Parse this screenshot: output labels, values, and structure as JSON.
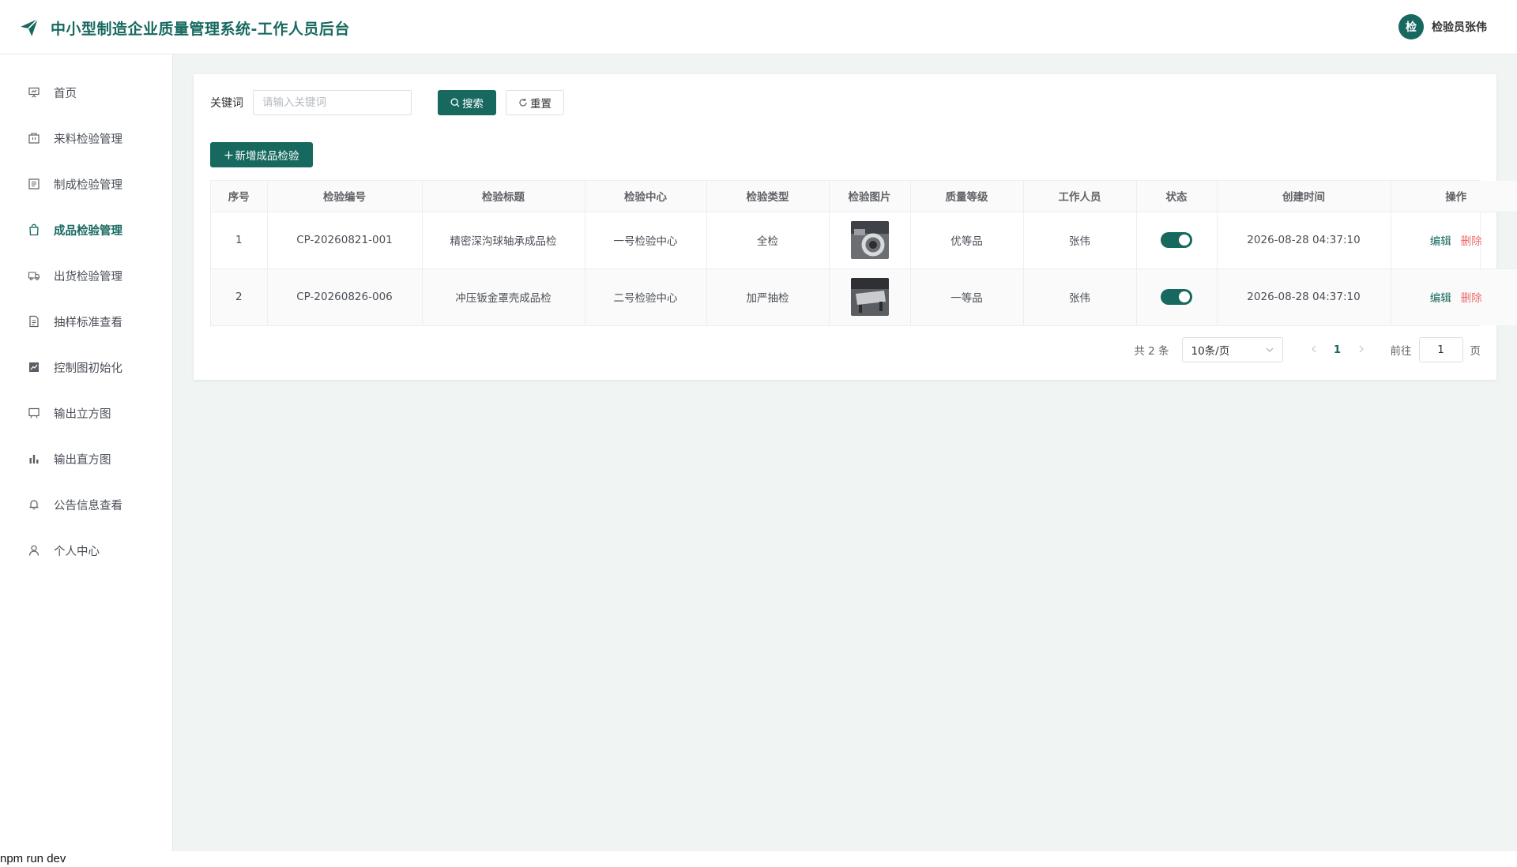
{
  "header": {
    "title": "中小型制造企业质量管理系统-工作人员后台",
    "avatar_text": "检",
    "user_name": "检验员张伟",
    "logo_icon": "paper-plane-icon"
  },
  "sidebar": {
    "items": [
      {
        "label": "首页",
        "icon": "presentation-icon",
        "active": false
      },
      {
        "label": "来料检验管理",
        "icon": "box-icon",
        "active": false
      },
      {
        "label": "制成检验管理",
        "icon": "list-icon",
        "active": false
      },
      {
        "label": "成品检验管理",
        "icon": "bag-icon",
        "active": true
      },
      {
        "label": "出货检验管理",
        "icon": "truck-icon",
        "active": false
      },
      {
        "label": "抽样标准查看",
        "icon": "document-icon",
        "active": false
      },
      {
        "label": "控制图初始化",
        "icon": "line-chart-icon",
        "active": false
      },
      {
        "label": "输出立方图",
        "icon": "board-icon",
        "active": false
      },
      {
        "label": "输出直方图",
        "icon": "bar-chart-icon",
        "active": false
      },
      {
        "label": "公告信息查看",
        "icon": "bell-icon",
        "active": false
      },
      {
        "label": "个人中心",
        "icon": "user-icon",
        "active": false
      }
    ]
  },
  "search": {
    "label": "关键词",
    "placeholder": "请输入关键词",
    "value": "",
    "search_label": "搜索",
    "reset_label": "重置"
  },
  "add_button_label": "新增成品检验",
  "table": {
    "headers": [
      "序号",
      "检验编号",
      "检验标题",
      "检验中心",
      "检验类型",
      "检验图片",
      "质量等级",
      "工作人员",
      "状态",
      "创建时间",
      "操作"
    ],
    "rows": [
      {
        "index": "1",
        "code": "CP-20260821-001",
        "title": "精密深沟球轴承成品检",
        "center": "一号检验中心",
        "type": "全检",
        "grade": "优等品",
        "staff": "张伟",
        "status_on": true,
        "created": "2026-08-28 04:37:10"
      },
      {
        "index": "2",
        "code": "CP-20260826-006",
        "title": "冲压钣金罩壳成品检",
        "center": "二号检验中心",
        "type": "加严抽检",
        "grade": "一等品",
        "staff": "张伟",
        "status_on": true,
        "created": "2026-08-28 04:37:10"
      }
    ],
    "edit_label": "编辑",
    "delete_label": "删除"
  },
  "pagination": {
    "total_text": "共 2 条",
    "page_size": "10条/页",
    "current_page": "1",
    "goto_label": "前往",
    "goto_value": "1",
    "page_suffix": "页"
  },
  "footer_text": "npm run dev",
  "colors": {
    "primary": "#17695f",
    "danger": "#f06a6a",
    "background": "#f0f4f3"
  }
}
